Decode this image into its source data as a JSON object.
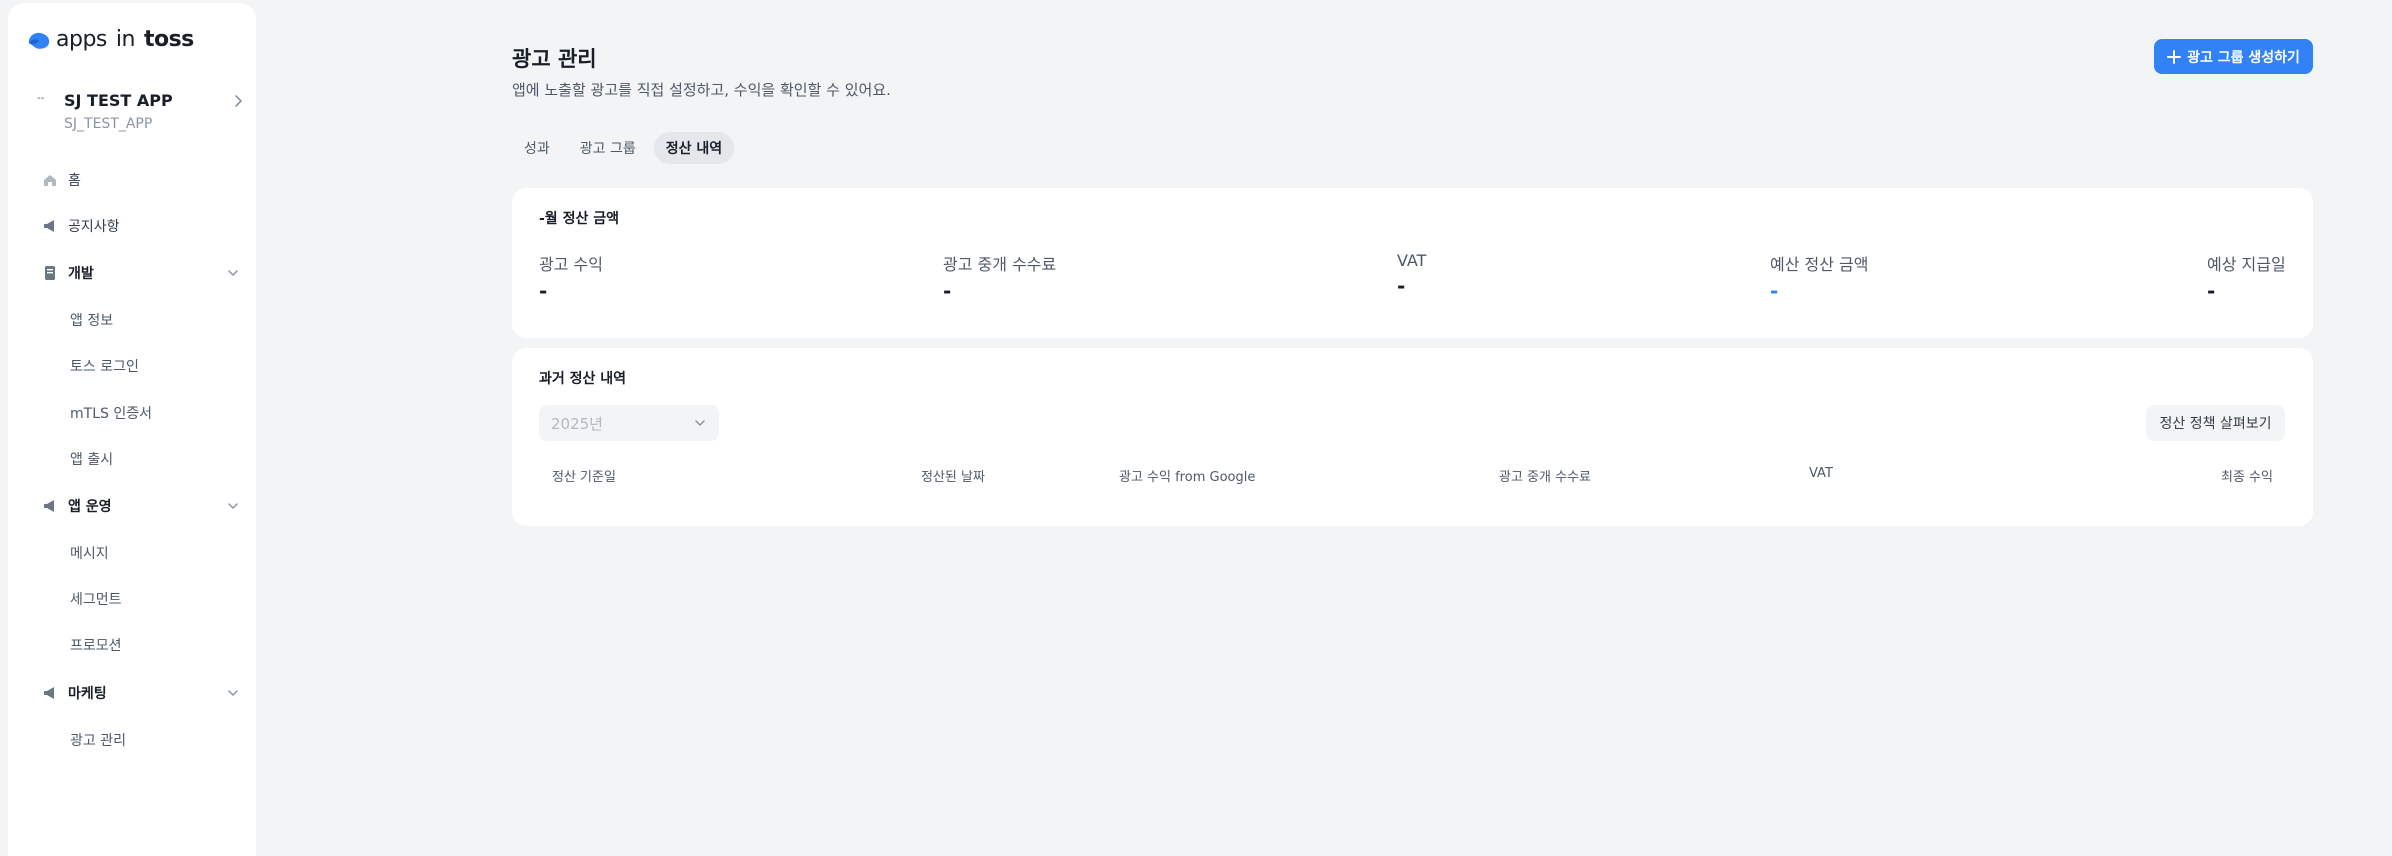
{
  "logo": {
    "apps": "apps",
    "in": "in",
    "toss": "toss"
  },
  "app_switcher": {
    "tiny": "--",
    "name": "SJ TEST APP",
    "id": "SJ_TEST_APP"
  },
  "nav": {
    "home": "홈",
    "notice": "공지사항",
    "dev": "개발",
    "app_info": "앱 정보",
    "toss_login": "토스 로그인",
    "mtls": "mTLS 인증서",
    "release": "앱 출시",
    "ops": "앱 운영",
    "message": "메시지",
    "segment": "세그먼트",
    "promotion": "프로모션",
    "marketing": "마케팅",
    "ad_manage": "광고 관리"
  },
  "header": {
    "title": "광고 관리",
    "description": "앱에 노출할 광고를 직접 설정하고, 수익을 확인할 수 있어요.",
    "create_button": "광고 그룹 생성하기"
  },
  "tabs": [
    "성과",
    "광고 그룹",
    "정산 내역"
  ],
  "active_tab": "정산 내역",
  "summary": {
    "title": "-월 정산 금액",
    "metrics": [
      {
        "label": "광고 수익",
        "value": "-"
      },
      {
        "label": "광고 중개 수수료",
        "value": "-"
      },
      {
        "label": "VAT",
        "value": "-"
      },
      {
        "label": "예산 정산 금액",
        "value": "-"
      },
      {
        "label": "예상 지급일",
        "value": "-"
      }
    ]
  },
  "history": {
    "title": "과거 정산 내역",
    "year_select": "2025년",
    "policy_button": "정산 정책 살펴보기",
    "columns": [
      "정산 기준일",
      "정산된 날짜",
      "광고 수익 from Google",
      "광고 중개 수수료",
      "VAT",
      "최종 수익"
    ]
  },
  "colors": {
    "accent": "#3182f6",
    "background": "#f2f4f6",
    "card": "#ffffff"
  }
}
